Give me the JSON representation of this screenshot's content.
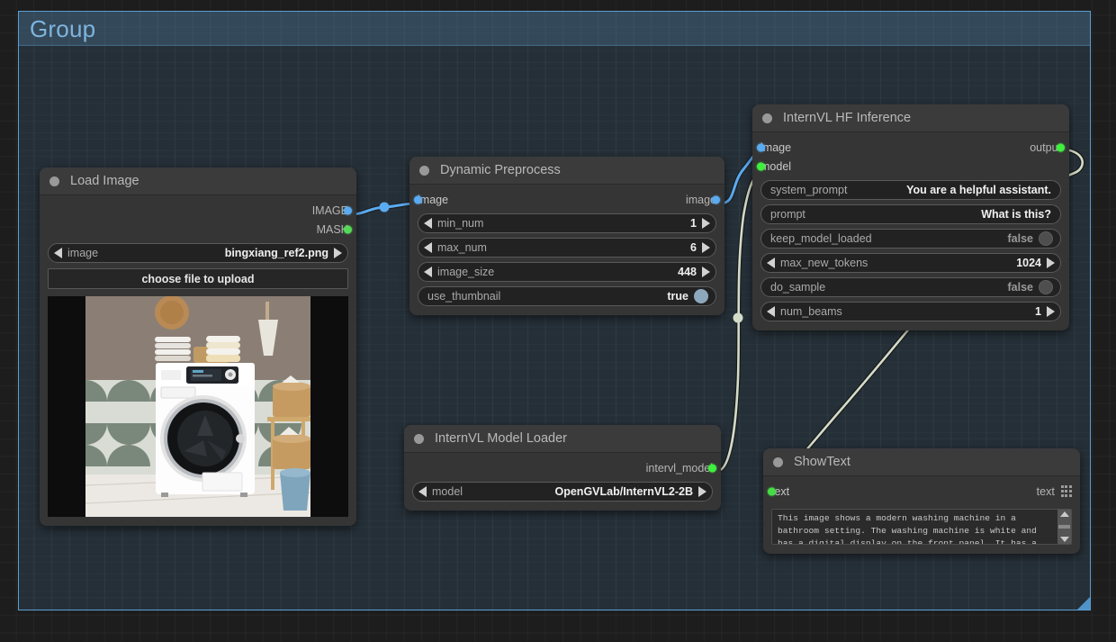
{
  "group": {
    "title": "Group",
    "color": "#5a9fd4"
  },
  "nodes": {
    "load_image": {
      "title": "Load Image",
      "outputs": [
        {
          "label": "IMAGE",
          "color": "#5aabf0"
        },
        {
          "label": "MASK",
          "color": "#54d956"
        }
      ],
      "widgets": {
        "image_name": "image",
        "image_value": "bingxiang_ref2.png",
        "upload_button": "choose file to upload"
      },
      "preview_alt": "washing-machine-in-bathroom"
    },
    "dynamic_preprocess": {
      "title": "Dynamic Preprocess",
      "input": {
        "label": "image",
        "color": "#5aabf0"
      },
      "output": {
        "label": "image",
        "color": "#5aabf0"
      },
      "widgets": [
        {
          "name": "min_num",
          "value": "1",
          "type": "number"
        },
        {
          "name": "max_num",
          "value": "6",
          "type": "number"
        },
        {
          "name": "image_size",
          "value": "448",
          "type": "number"
        },
        {
          "name": "use_thumbnail",
          "value": "true",
          "type": "toggle_on"
        }
      ]
    },
    "internvl_hf_inference": {
      "title": "InternVL HF Inference",
      "inputs": [
        {
          "label": "image",
          "color": "#5aabf0"
        },
        {
          "label": "model",
          "color": "#3ff03f"
        }
      ],
      "output": {
        "label": "output",
        "color": "#3ff03f"
      },
      "widgets": [
        {
          "name": "system_prompt",
          "value": "You are a helpful assistant.",
          "type": "text"
        },
        {
          "name": "prompt",
          "value": "What is this?",
          "type": "text"
        },
        {
          "name": "keep_model_loaded",
          "value": "false",
          "type": "toggle_off"
        },
        {
          "name": "max_new_tokens",
          "value": "1024",
          "type": "number"
        },
        {
          "name": "do_sample",
          "value": "false",
          "type": "toggle_off"
        },
        {
          "name": "num_beams",
          "value": "1",
          "type": "number"
        }
      ]
    },
    "internvl_model_loader": {
      "title": "InternVL Model Loader",
      "output": {
        "label": "intervl_model",
        "color": "#3ff03f"
      },
      "widgets": [
        {
          "name": "model",
          "value": "OpenGVLab/InternVL2-2B",
          "type": "number"
        }
      ]
    },
    "show_text": {
      "title": "ShowText",
      "input": {
        "label": "text",
        "color": "#45dd45"
      },
      "output_label": "text",
      "output_icon": "grid-dots-icon",
      "text_value": "This image shows a modern washing machine in a bathroom setting. The washing machine is white and has a digital display on the front panel. It has a large, front-"
    }
  }
}
